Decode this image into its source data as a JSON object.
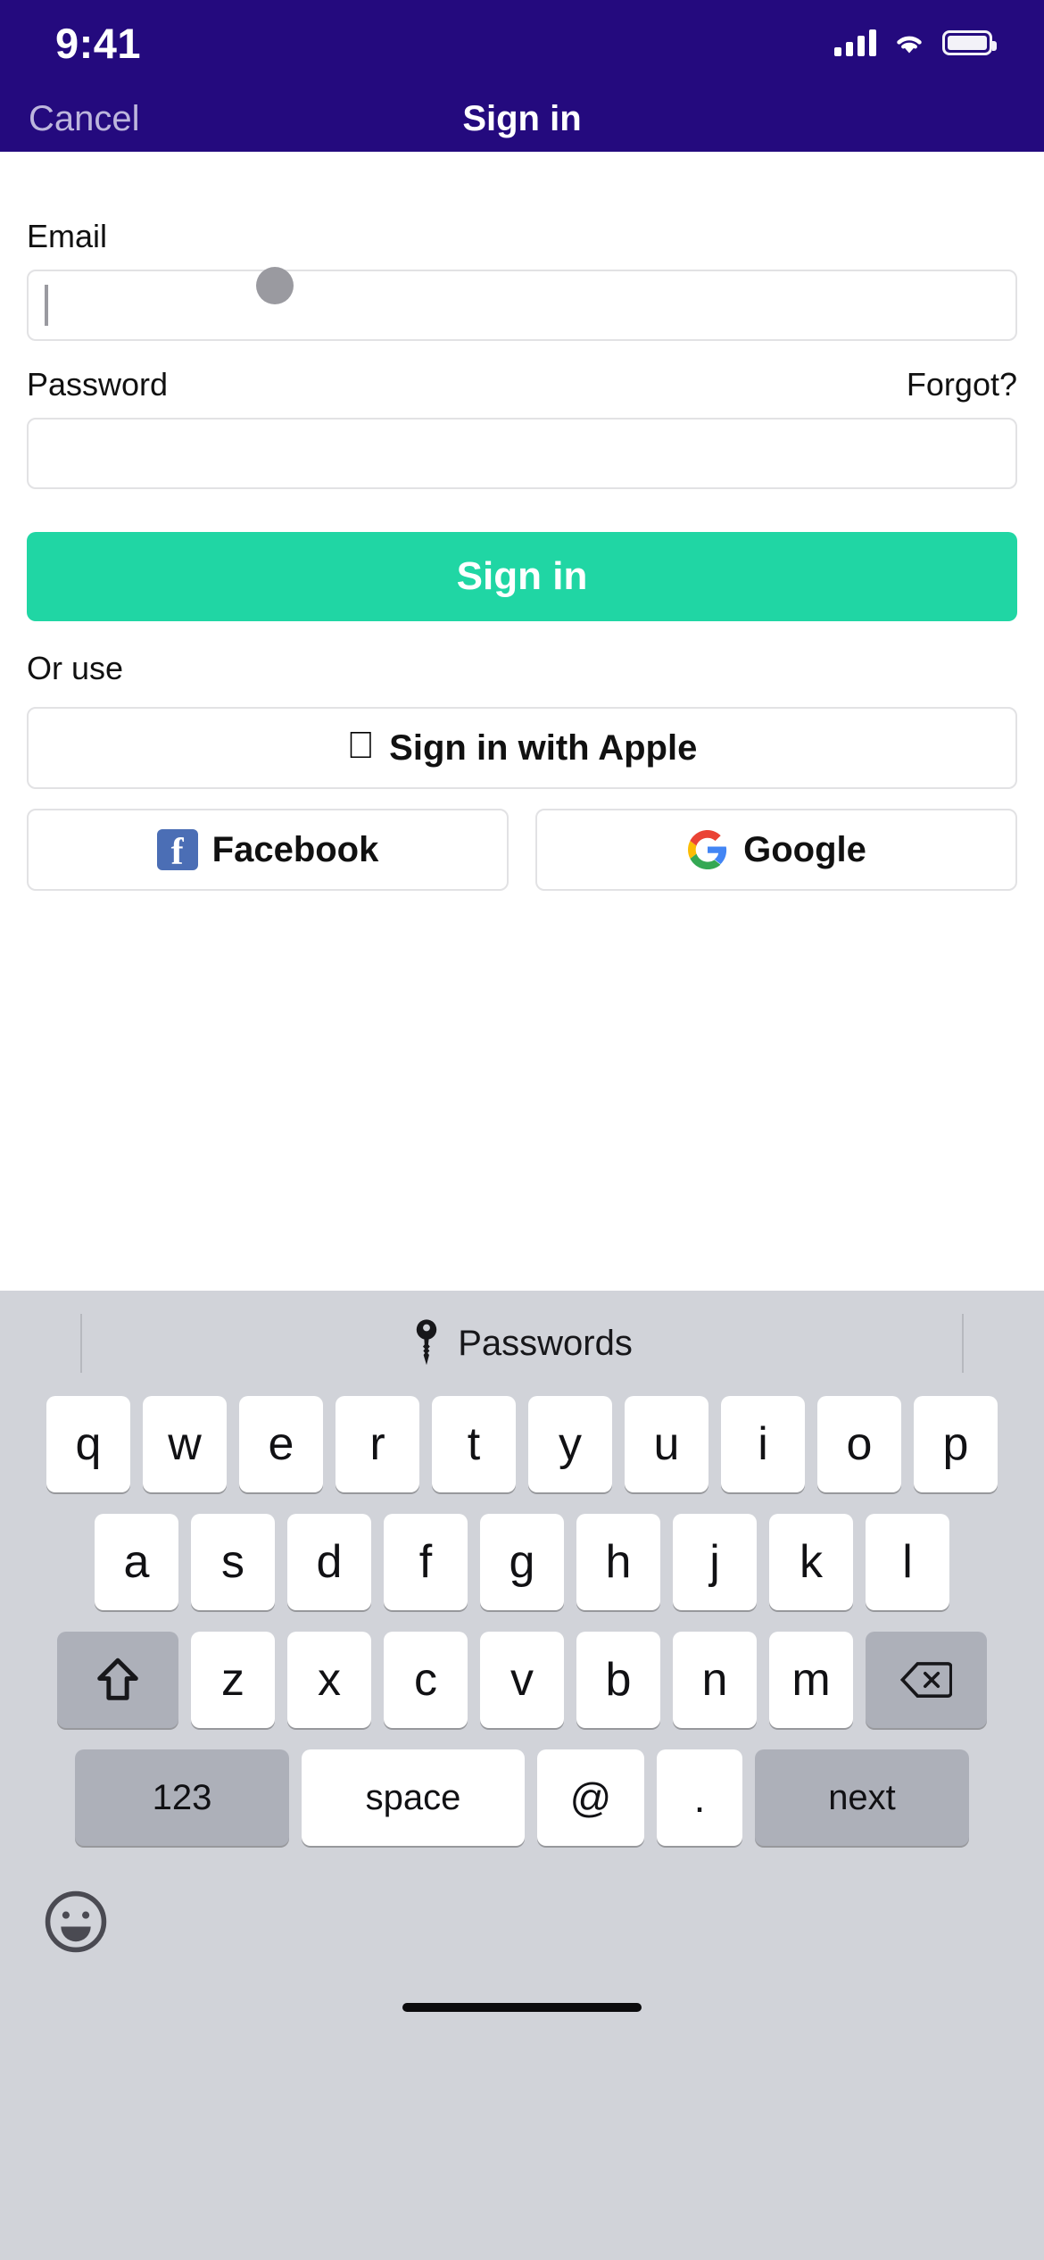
{
  "status_bar": {
    "time": "9:41",
    "cellular_icon": "cellular-signal-icon",
    "wifi_icon": "wifi-icon",
    "battery_icon": "battery-icon"
  },
  "nav_bar": {
    "cancel_label": "Cancel",
    "title": "Sign in",
    "background_color": "#240A7E",
    "cancel_color": "#BDB6DD"
  },
  "form": {
    "email": {
      "label": "Email",
      "value": "",
      "placeholder": "",
      "focused": true
    },
    "password": {
      "label": "Password",
      "forgot_label": "Forgot?",
      "value": "",
      "placeholder": ""
    },
    "submit": {
      "label": "Sign in",
      "color": "#20D6A4",
      "text_color": "#ffffff"
    },
    "or_use_label": "Or use",
    "social": {
      "apple": {
        "label": "Sign in with Apple",
        "icon": "apple-logo-icon"
      },
      "facebook": {
        "label": "Facebook",
        "icon": "facebook-logo-icon",
        "color": "#4B6EB5"
      },
      "google": {
        "label": "Google",
        "icon": "google-logo-icon"
      }
    }
  },
  "keyboard": {
    "toolbar": {
      "passwords_label": "Passwords",
      "key_icon": "key-icon"
    },
    "rows": {
      "row1": [
        "q",
        "w",
        "e",
        "r",
        "t",
        "y",
        "u",
        "i",
        "o",
        "p"
      ],
      "row2": [
        "a",
        "s",
        "d",
        "f",
        "g",
        "h",
        "j",
        "k",
        "l"
      ],
      "row3": [
        "z",
        "x",
        "c",
        "v",
        "b",
        "n",
        "m"
      ],
      "shift_icon": "shift-arrow-icon",
      "backspace_icon": "backspace-icon"
    },
    "bottom_row": {
      "numbers_label": "123",
      "space_label": "space",
      "at_label": "@",
      "period_label": ".",
      "return_label": "next"
    },
    "emoji_icon": "emoji-smiley-icon",
    "background_color": "#D1D3D9"
  }
}
